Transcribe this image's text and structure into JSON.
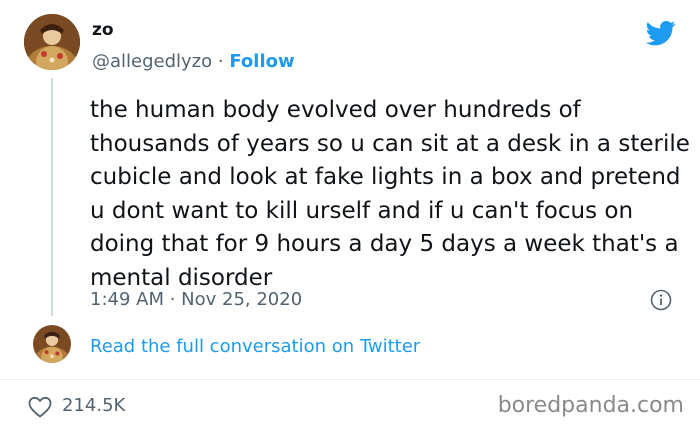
{
  "author": {
    "name": "zo",
    "handle": "@allegedlyzo",
    "separator": "·",
    "follow_label": "Follow"
  },
  "tweet": {
    "text": "the human body evolved over hundreds of thousands of years so u can sit at a desk in a sterile cubicle and look at fake lights in a box and pretend u dont want to kill urself and if u can't focus on doing that for 9 hours a day 5 days a week that's a mental disorder",
    "timestamp": "1:49 AM · Nov 25, 2020"
  },
  "conversation": {
    "read_full_label": "Read the full conversation on Twitter"
  },
  "engagement": {
    "likes": "214.5K"
  },
  "watermark": "boredpanda.com",
  "colors": {
    "accent": "#1d9bf0",
    "secondary_text": "#536471",
    "primary_text": "#0f1419"
  },
  "icons": {
    "brand": "twitter-bird-icon",
    "info": "info-icon",
    "like": "heart-icon"
  }
}
